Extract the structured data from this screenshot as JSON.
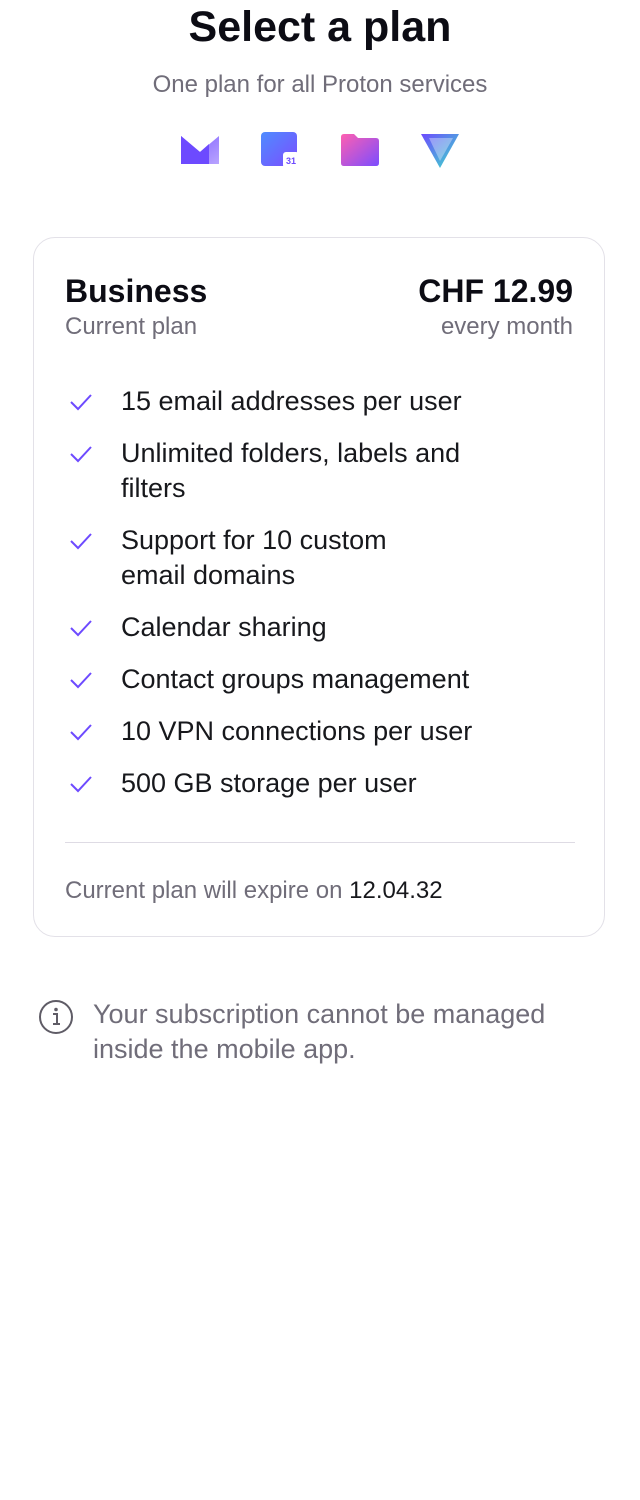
{
  "header": {
    "title": "Select a plan",
    "subtitle": "One plan for all Proton services"
  },
  "app_icons": [
    "proton-mail-icon",
    "proton-calendar-icon",
    "proton-drive-icon",
    "proton-vpn-icon"
  ],
  "calendar_icon_day": "31",
  "plan": {
    "name": "Business",
    "status": "Current plan",
    "price": "CHF 12.99",
    "period": "every month",
    "features": [
      "15 email addresses per user",
      "Unlimited folders, labels and filters",
      "Support for 10 custom email domains",
      "Calendar sharing",
      "Contact groups management",
      "10 VPN connections per user",
      "500 GB storage per user"
    ],
    "expiry_label": "Current plan will expire on",
    "expiry_date": "12.04.32"
  },
  "notice": {
    "icon": "info-icon",
    "text": "Your subscription cannot be managed inside the mobile app."
  },
  "colors": {
    "accent": "#6d4aff",
    "text_primary": "#0c0c14",
    "text_secondary": "#706d79",
    "card_border": "#e3e1e8"
  }
}
